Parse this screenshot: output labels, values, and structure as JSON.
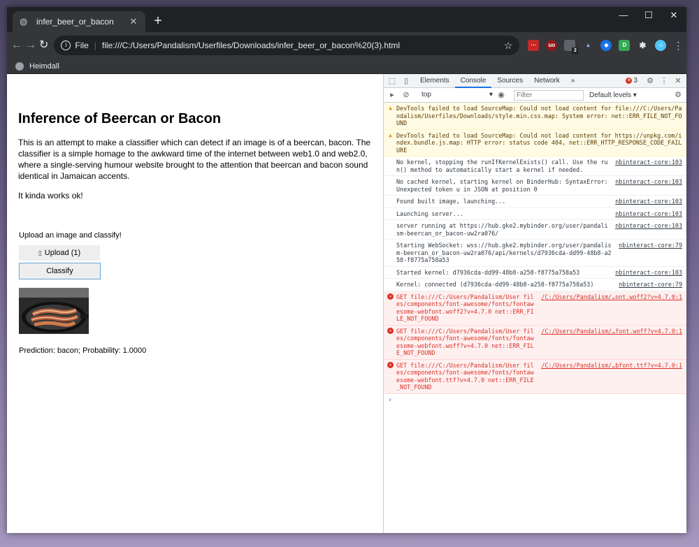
{
  "browser": {
    "tab_title": "infer_beer_or_bacon",
    "url_scheme": "File",
    "url": "file:///C:/Users/Pandalism/Userfiles/Downloads/infer_beer_or_bacon%20(3).html",
    "bookmark": "Heimdall",
    "ext_badge": "2"
  },
  "page": {
    "title": "Inference of Beercan or Bacon",
    "intro": "This is an attempt to make a classifier which can detect if an image is of a beercan, bacon. The classifier is a simple homage to the awkward time of the internet between web1.0 and web2.0, where a single-serving humour website brought to the attention that beercan and bacon sound identical in Jamaican accents.",
    "note": "It kinda works ok!",
    "upload_label": "Upload an image and classify!",
    "upload_button": "Upload (1)",
    "classify_button": "Classify",
    "prediction": "Prediction: bacon; Probability: 1.0000"
  },
  "devtools": {
    "tabs": [
      "Elements",
      "Console",
      "Sources",
      "Network"
    ],
    "more": "»",
    "error_count": "3",
    "context": "top",
    "filter_placeholder": "Filter",
    "levels": "Default levels ▾",
    "messages": [
      {
        "type": "warn",
        "text": "DevTools failed to load SourceMap: Could not load content for file:///C:/Users/Pandalism/Userfiles/Downloads/style.min.css.map: System error: net::ERR_FILE_NOT_FOUND",
        "source": ""
      },
      {
        "type": "warn",
        "text": "DevTools failed to load SourceMap: Could not load content for https://unpkg.com/index.bundle.js.map: HTTP error: status code 404, net::ERR_HTTP_RESPONSE_CODE_FAILURE",
        "source": ""
      },
      {
        "type": "info",
        "text": "No kernel, stopping the runIfKernelExists() call. Use the run() method to automatically start a kernel if needed.",
        "source": "nbinteract-core:103"
      },
      {
        "type": "info",
        "text": "No cached kernel, starting kernel on BinderHub: SyntaxError: Unexpected token u in JSON at position 0",
        "source": "nbinteract-core:103"
      },
      {
        "type": "info",
        "text": "Found built image, launching...",
        "source": "nbinteract-core:103"
      },
      {
        "type": "info",
        "text": "Launching server...",
        "source": "nbinteract-core:103"
      },
      {
        "type": "info",
        "text": "server running at https://hub.gke2.mybinder.org/user/pandalism-beercan_or_bacon-uw2ra076/",
        "source": "nbinteract-core:103"
      },
      {
        "type": "info",
        "text": "Starting WebSocket: wss://hub.gke2.mybinder.org/user/pandalism-beercan_or_bacon-uw2ra076/api/kernels/d7936cda-dd99-48b8-a258-f8775a758a53",
        "source": "nbinteract-core:79"
      },
      {
        "type": "info",
        "text": "Started kernel: d7936cda-dd99-48b8-a258-f8775a758a53",
        "source": "nbinteract-core:103"
      },
      {
        "type": "info",
        "text": "Kernel: connected (d7936cda-dd99-48b8-a258-f8775a758a53)",
        "source": "nbinteract-core:79"
      },
      {
        "type": "error",
        "text": "GET file:///C:/Users/Pandalism/User files/components/font-awesome/fonts/fontawesome-webfont.woff2?v=4.7.0 net::ERR_FILE_NOT_FOUND",
        "source": "/C:/Users/Pandalism/…ont.woff2?v=4.7.0:1"
      },
      {
        "type": "error",
        "text": "GET file:///C:/Users/Pandalism/User files/components/font-awesome/fonts/fontawesome-webfont.woff?v=4.7.0 net::ERR_FILE_NOT_FOUND",
        "source": "/C:/Users/Pandalism/…font.woff?v=4.7.0:1"
      },
      {
        "type": "error",
        "text": "GET file:///C:/Users/Pandalism/User files/components/font-awesome/fonts/fontawesome-webfont.ttf?v=4.7.0 net::ERR_FILE_NOT_FOUND",
        "source": "/C:/Users/Pandalism/…bfont.ttf?v=4.7.0:1"
      }
    ],
    "prompt": "›"
  },
  "colors": {
    "tab_strip": "#202124",
    "toolbar": "#35363a",
    "devtools_accent": "#1a73e8",
    "error_red": "#d93025",
    "warning_yellow": "#fffbe5"
  }
}
